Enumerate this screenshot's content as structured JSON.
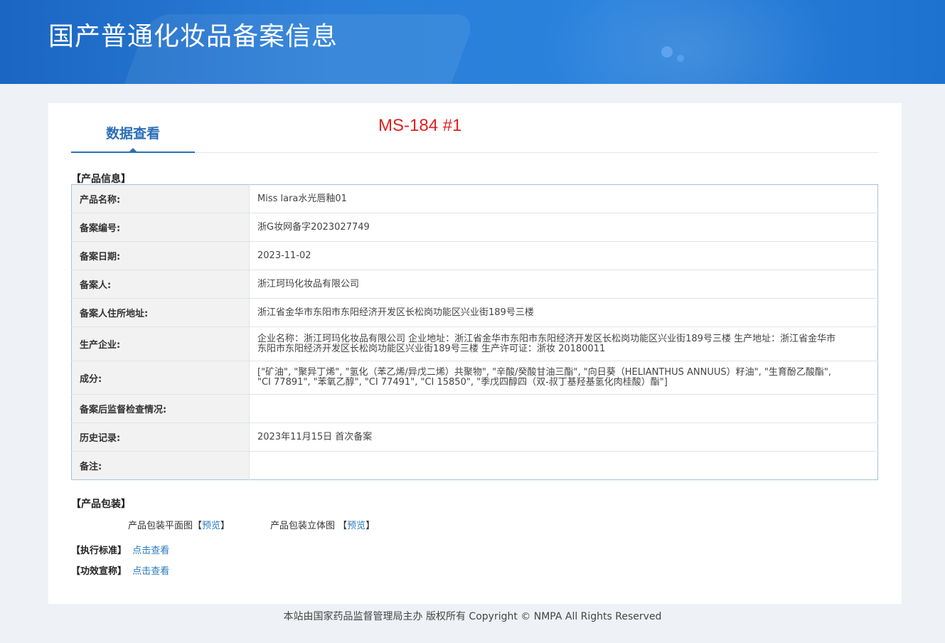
{
  "banner": {
    "title": "国产普通化妆品备案信息"
  },
  "tab": {
    "label": "数据查看"
  },
  "stamp": {
    "text": "MS-184 #1"
  },
  "sections": {
    "product_info": "【产品信息】",
    "packaging": "【产品包装】"
  },
  "rows": [
    {
      "key": "产品名称:",
      "value": "Miss lara水光唇釉01"
    },
    {
      "key": "备案编号:",
      "value": "浙G妆网备字2023027749"
    },
    {
      "key": "备案日期:",
      "value": "2023-11-02"
    },
    {
      "key": "备案人:",
      "value": "浙江珂玛化妆品有限公司"
    },
    {
      "key": "备案人住所地址:",
      "value": "浙江省金华市东阳市东阳经济开发区长松岗功能区兴业街189号三楼"
    },
    {
      "key": "生产企业:",
      "value": "企业名称：浙江珂玛化妆品有限公司 企业地址：浙江省金华市东阳市东阳经济开发区长松岗功能区兴业街189号三楼 生产地址：浙江省金华市东阳市东阳经济开发区长松岗功能区兴业街189号三楼 生产许可证：浙妆 20180011"
    },
    {
      "key": "成分:",
      "value": "[\"矿油\", \"聚异丁烯\", \"氢化（苯乙烯/异戊二烯）共聚物\", \"辛酸/癸酸甘油三酯\", \"向日葵（HELIANTHUS ANNUUS）籽油\", \"生育酚乙酸酯\", \"CI 77891\", \"苯氧乙醇\", \"CI 77491\", \"CI 15850\", \"季戊四醇四（双-叔丁基羟基氢化肉桂酸）酯\"]"
    },
    {
      "key": "备案后监督检查情况:",
      "value": ""
    },
    {
      "key": "历史记录:",
      "value": "2023年11月15日 首次备案"
    },
    {
      "key": "备注:",
      "value": ""
    }
  ],
  "packaging": {
    "flat_label": "产品包装平面图",
    "flat_open": "【",
    "flat_link": "预览",
    "flat_close": "】",
    "stereo_label": "产品包装立体图",
    "stereo_open": "【",
    "stereo_link": "预览",
    "stereo_close": "】"
  },
  "links": {
    "standard_label": "【执行标准】",
    "standard_link": "点击查看",
    "efficacy_label": "【功效宣称】",
    "efficacy_link": "点击查看"
  },
  "footer": {
    "text": "本站由国家药品监督管理局主办 版权所有 Copyright © NMPA All Rights Reserved"
  }
}
